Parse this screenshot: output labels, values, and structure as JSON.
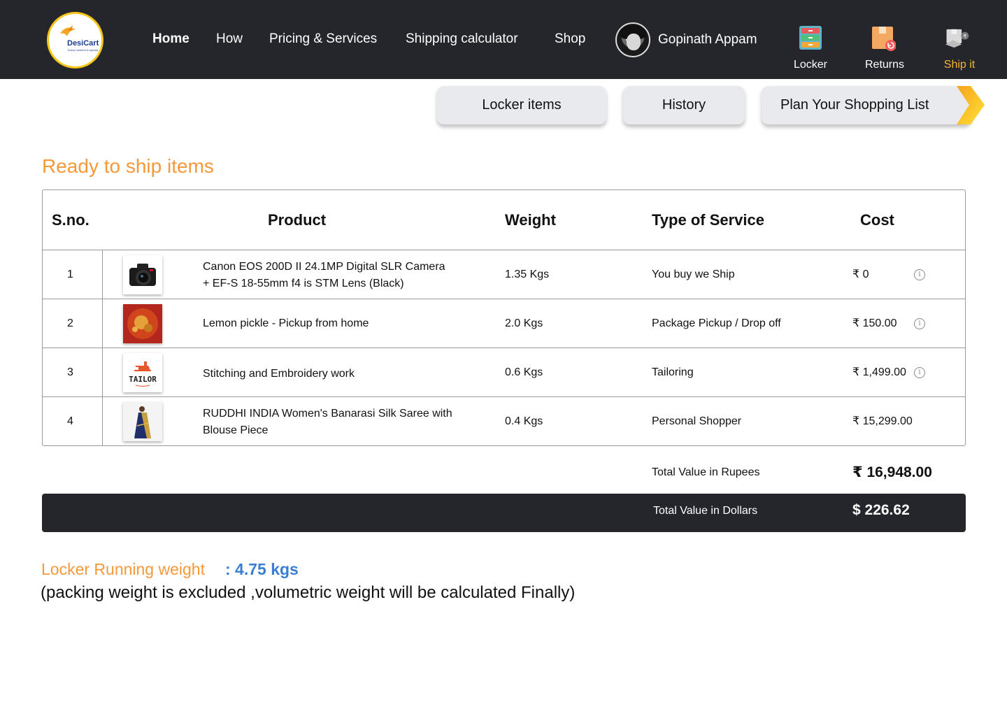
{
  "brand": {
    "name": "DesiCart",
    "tagline": "Every moment is special"
  },
  "nav": {
    "items": [
      {
        "label": "Home",
        "active": true
      },
      {
        "label": "How"
      },
      {
        "label": "Pricing & Services"
      },
      {
        "label": "Shipping calculator"
      },
      {
        "label": "Shop"
      }
    ]
  },
  "user": {
    "name": "Gopinath Appam"
  },
  "top_icons": [
    {
      "label": "Locker",
      "icon": "locker-icon"
    },
    {
      "label": "Returns",
      "icon": "returns-icon"
    },
    {
      "label": "Ship it",
      "icon": "ship-it-icon",
      "active": true
    }
  ],
  "actions": {
    "locker_items": "Locker items",
    "history": "History",
    "plan": "Plan Your Shopping List"
  },
  "section_title": "Ready to ship items",
  "table": {
    "headers": {
      "sno": "S.no.",
      "product": "Product",
      "weight": "Weight",
      "service": "Type of Service",
      "cost": "Cost"
    },
    "rows": [
      {
        "sno": "1",
        "product_line1": "Canon EOS 200D II 24.1MP Digital SLR Camera",
        "product_line2": "+ EF-S 18-55mm f4 is STM Lens (Black)",
        "weight": "1.35 Kgs",
        "service": "You buy we Ship",
        "cost": "₹ 0",
        "thumb": "camera-thumbnail",
        "info": true
      },
      {
        "sno": "2",
        "product_line1": "Lemon pickle - Pickup from home",
        "product_line2": "",
        "weight": "2.0 Kgs",
        "service": "Package Pickup / Drop off",
        "cost": "₹ 150.00",
        "thumb": "pickle-thumbnail",
        "info": true
      },
      {
        "sno": "3",
        "product_line1": "Stitching and Embroidery work",
        "product_line2": "",
        "weight": "0.6 Kgs",
        "service": "Tailoring",
        "cost": "₹ 1,499.00",
        "thumb": "tailor-thumbnail",
        "thumb_text": "TAILOR",
        "info": true
      },
      {
        "sno": "4",
        "product_line1": "RUDDHI INDIA Women's Banarasi Silk Saree with",
        "product_line2": "Blouse Piece",
        "weight": "0.4 Kgs",
        "service": "Personal Shopper",
        "cost": "₹ 15,299.00",
        "thumb": "saree-thumbnail",
        "info": false
      }
    ]
  },
  "totals": {
    "rupees_label": "Total Value in Rupees",
    "rupees_value": "₹ 16,948.00",
    "dollars_label": "Total Value in Dollars",
    "dollars_value": "$ 226.62"
  },
  "locker_weight": {
    "label": "Locker Running weight",
    "value": ": 4.75 kgs",
    "note": "(packing weight is excluded ,volumetric weight will be calculated Finally)"
  },
  "colors": {
    "header_bg": "#24262b",
    "accent_orange": "#f5993a",
    "accent_blue": "#3a7fd5",
    "ship_it": "#f5b731"
  }
}
